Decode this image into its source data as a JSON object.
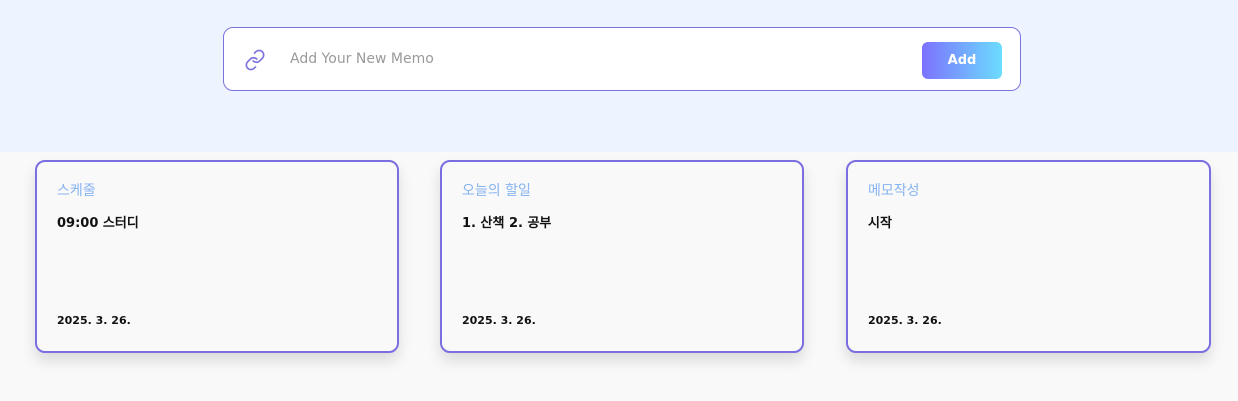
{
  "memo_input": {
    "placeholder": "Add Your New Memo",
    "value": "",
    "icon": "link-icon"
  },
  "add_button": {
    "label": "Add"
  },
  "colors": {
    "top_background": "#eef4ff",
    "accent_border": "#7b6ee0",
    "card_title": "#86b4f0",
    "button_gradient_start": "#7d72ff",
    "button_gradient_end": "#6bdcfd"
  },
  "memos": [
    {
      "title": "스케줄",
      "content": "09:00 스터디",
      "date": "2025. 3. 26."
    },
    {
      "title": "오늘의 할일",
      "content": "1. 산책 2. 공부",
      "date": "2025. 3. 26."
    },
    {
      "title": "메모작성",
      "content": "시작",
      "date": "2025. 3. 26."
    }
  ]
}
